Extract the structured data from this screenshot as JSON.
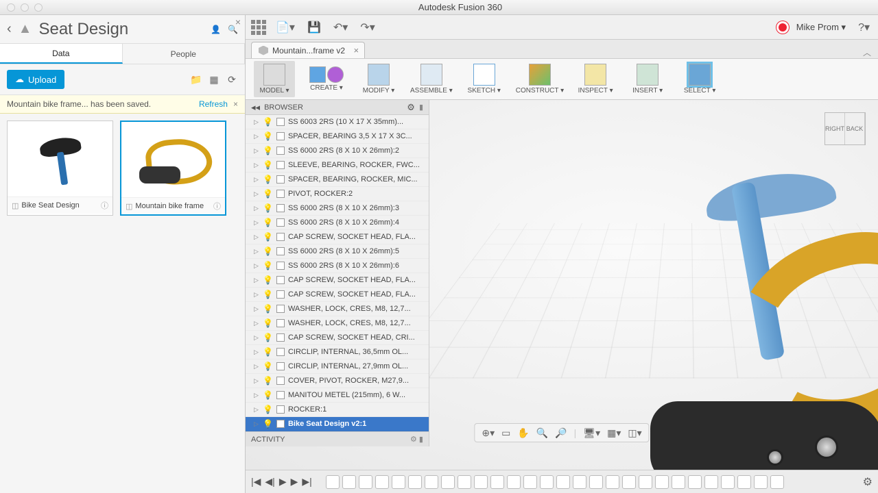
{
  "app_title": "Autodesk Fusion 360",
  "user_name": "Mike Prom",
  "left": {
    "title": "Seat Design",
    "tabs": {
      "data": "Data",
      "people": "People"
    },
    "upload": "Upload",
    "notification": "Mountain bike frame... has been saved.",
    "refresh": "Refresh",
    "cards": [
      {
        "name": "Bike Seat Design"
      },
      {
        "name": "Mountain bike frame"
      }
    ]
  },
  "doc_tab": "Mountain...frame v2",
  "ribbon": {
    "model": "MODEL",
    "create": "CREATE",
    "modify": "MODIFY",
    "assemble": "ASSEMBLE",
    "sketch": "SKETCH",
    "construct": "CONSTRUCT",
    "inspect": "INSPECT",
    "insert": "INSERT",
    "select": "SELECT"
  },
  "browser": {
    "title": "BROWSER",
    "activity": "ACTIVITY",
    "items": [
      "SS 6003 2RS (10 X 17 X 35mm)...",
      "SPACER, BEARING 3,5 X 17 X 3C...",
      "SS 6000 2RS (8 X 10 X 26mm):2",
      "SLEEVE, BEARING, ROCKER, FWC...",
      "SPACER, BEARING, ROCKER, MIC...",
      "PIVOT, ROCKER:2",
      "SS 6000 2RS (8 X 10 X 26mm):3",
      "SS 6000 2RS (8 X 10 X 26mm):4",
      "CAP SCREW, SOCKET HEAD, FLA...",
      "SS 6000 2RS (8 X 10 X 26mm):5",
      "SS 6000 2RS (8 X 10 X 26mm):6",
      "CAP SCREW, SOCKET HEAD, FLA...",
      "CAP SCREW, SOCKET HEAD, FLA...",
      "WASHER, LOCK, CRES, M8, 12,7...",
      "WASHER, LOCK, CRES, M8, 12,7...",
      "CAP SCREW, SOCKET HEAD, CRI...",
      "CIRCLIP, INTERNAL, 36,5mm OL...",
      "CIRCLIP, INTERNAL, 27,9mm OL...",
      "COVER, PIVOT, ROCKER, M27,9...",
      "MANITOU METEL (215mm), 6 W...",
      "ROCKER:1",
      "Bike Seat Design  v2:1"
    ],
    "selected_index": 21
  },
  "viewcube": {
    "right": "RIGHT",
    "back": "BACK"
  }
}
